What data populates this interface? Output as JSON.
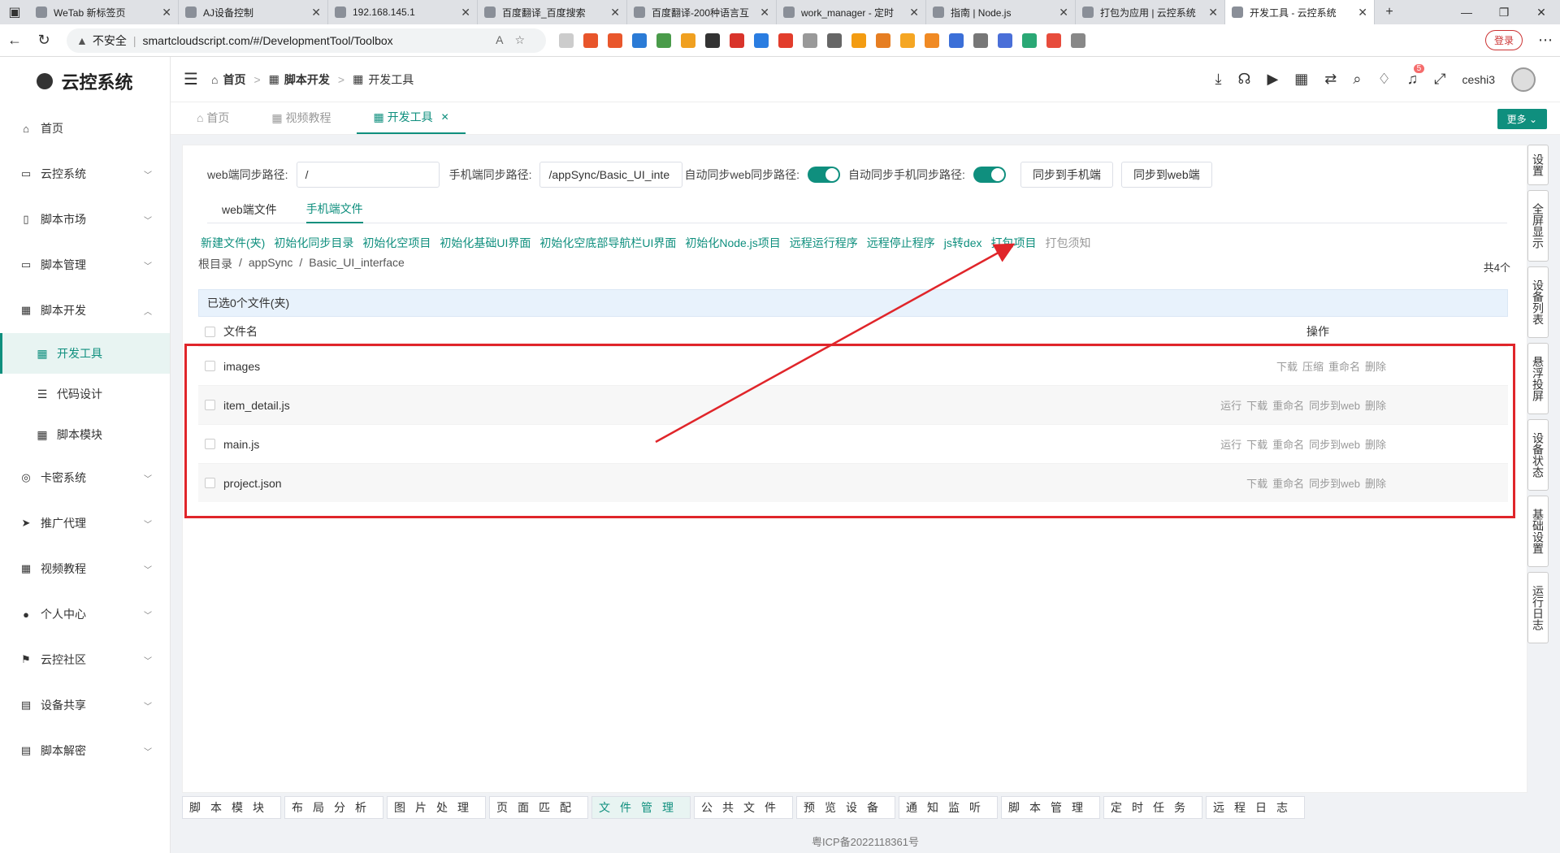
{
  "browser": {
    "tabs": [
      {
        "title": "WeTab 新标签页",
        "active": false
      },
      {
        "title": "AJ设备控制",
        "active": false
      },
      {
        "title": "192.168.145.1",
        "active": false
      },
      {
        "title": "百度翻译_百度搜索",
        "active": false
      },
      {
        "title": "百度翻译-200种语言互",
        "active": false
      },
      {
        "title": "work_manager - 定时",
        "active": false
      },
      {
        "title": "指南 | Node.js",
        "active": false
      },
      {
        "title": "打包为应用 | 云控系统",
        "active": false
      },
      {
        "title": "开发工具 - 云控系统",
        "active": true
      }
    ],
    "insecure": "不安全",
    "url": "smartcloudscript.com/#/DevelopmentTool/Toolbox",
    "login": "登录"
  },
  "sidebar": {
    "logo": "云控系统",
    "items": [
      {
        "label": "首页",
        "icon": "home-icon",
        "glyph": "⌂"
      },
      {
        "label": "云控系统",
        "icon": "monitor-icon",
        "glyph": "▭"
      },
      {
        "label": "脚本市场",
        "icon": "phone-icon",
        "glyph": "▯"
      },
      {
        "label": "脚本管理",
        "icon": "briefcase-icon",
        "glyph": "▭"
      },
      {
        "label": "脚本开发",
        "icon": "grid-icon",
        "glyph": "▦"
      }
    ],
    "subitems": [
      {
        "label": "开发工具",
        "icon": "grid-icon",
        "glyph": "▦"
      },
      {
        "label": "代码设计",
        "icon": "sliders-icon",
        "glyph": "☰"
      },
      {
        "label": "脚本模块",
        "icon": "grid-icon",
        "glyph": "▦"
      }
    ],
    "items2": [
      {
        "label": "卡密系统",
        "icon": "key-icon",
        "glyph": "◎"
      },
      {
        "label": "推广代理",
        "icon": "send-icon",
        "glyph": "➤"
      },
      {
        "label": "视频教程",
        "icon": "grid-icon",
        "glyph": "▦"
      },
      {
        "label": "个人中心",
        "icon": "user-icon",
        "glyph": "●"
      },
      {
        "label": "云控社区",
        "icon": "flag-icon",
        "glyph": "⚑"
      },
      {
        "label": "设备共享",
        "icon": "share-icon",
        "glyph": "▤"
      },
      {
        "label": "脚本解密",
        "icon": "document-icon",
        "glyph": "▤"
      }
    ]
  },
  "topbar": {
    "breadcrumb": [
      "首页",
      "脚本开发",
      "开发工具"
    ],
    "notifications": "5",
    "user": "ceshi3"
  },
  "pagetabs": {
    "tabs": [
      "首页",
      "视频教程",
      "开发工具"
    ],
    "more": "更多"
  },
  "form": {
    "web_path_label": "web端同步路径:",
    "web_path_value": "/",
    "phone_path_label": "手机端同步路径:",
    "phone_path_value": "/appSync/Basic_UI_inte",
    "auto_web_label": "自动同步web同步路径:",
    "auto_phone_label": "自动同步手机同步路径:",
    "sync_phone_btn": "同步到手机端",
    "sync_web_btn": "同步到web端"
  },
  "subtabs": [
    "web端文件",
    "手机端文件"
  ],
  "actions": [
    "新建文件(夹)",
    "初始化同步目录",
    "初始化空项目",
    "初始化基础UI界面",
    "初始化空底部导航栏UI界面",
    "初始化Node.js项目",
    "远程运行程序",
    "远程停止程序",
    "js转dex",
    "打包项目"
  ],
  "actions_muted": "打包须知",
  "path": {
    "root": "根目录",
    "sep": "/",
    "p1": "appSync",
    "p2": "Basic_UI_interface"
  },
  "total": "共4个",
  "table": {
    "selected": "已选0个文件(夹)",
    "col_name": "文件名",
    "col_op": "操作",
    "rows": [
      {
        "name": "images",
        "ops": [
          "下载",
          "压缩",
          "重命名",
          "删除"
        ]
      },
      {
        "name": "item_detail.js",
        "ops": [
          "运行",
          "下载",
          "重命名",
          "同步到web",
          "删除"
        ]
      },
      {
        "name": "main.js",
        "ops": [
          "运行",
          "下载",
          "重命名",
          "同步到web",
          "删除"
        ]
      },
      {
        "name": "project.json",
        "ops": [
          "下载",
          "重命名",
          "同步到web",
          "删除"
        ]
      }
    ]
  },
  "rightrail": [
    "设置",
    "全屏显示",
    "设备列表",
    "悬浮投屏",
    "设备状态",
    "基础设置",
    "运行日志"
  ],
  "bottomtabs": [
    "脚本模块",
    "布局分析",
    "图片处理",
    "页面匹配",
    "文件管理",
    "公共文件",
    "预览设备",
    "通知监听",
    "脚本管理",
    "定时任务",
    "远程日志"
  ],
  "footer": "粤ICP备2022118361号",
  "colors": {
    "accent": "#0f8f7e",
    "annotation": "#e0252a"
  }
}
